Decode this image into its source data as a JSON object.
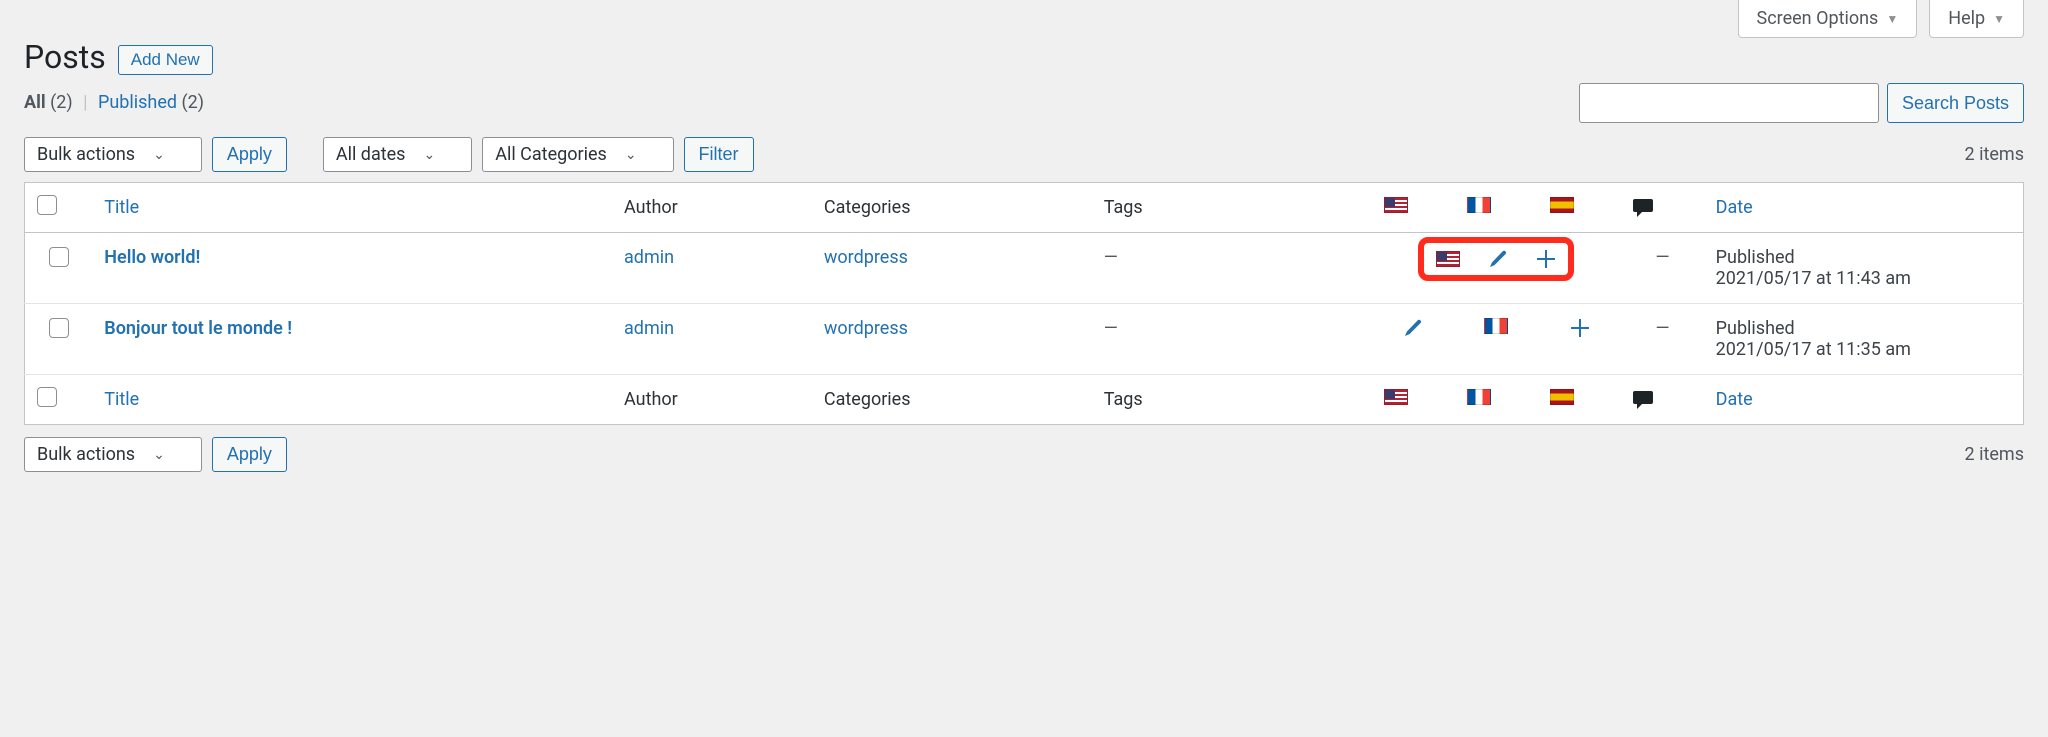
{
  "topTabs": {
    "screenOptions": "Screen Options",
    "help": "Help"
  },
  "heading": "Posts",
  "addNew": "Add New",
  "filters": {
    "allLabel": "All",
    "allCount": "(2)",
    "publishedLabel": "Published",
    "publishedCount": "(2)"
  },
  "search": {
    "button": "Search Posts",
    "placeholder": ""
  },
  "bulk": {
    "label": "Bulk actions",
    "apply": "Apply"
  },
  "dateFilter": "All dates",
  "catFilter": "All Categories",
  "filterBtn": "Filter",
  "itemsCount": "2 items",
  "columns": {
    "title": "Title",
    "author": "Author",
    "categories": "Categories",
    "tags": "Tags",
    "date": "Date"
  },
  "langs": [
    "us",
    "fr",
    "es"
  ],
  "rows": [
    {
      "title": "Hello world!",
      "author": "admin",
      "categories": "wordpress",
      "tags": "—",
      "comments": "—",
      "dateStatus": "Published",
      "dateValue": "2021/05/17 at 11:43 am",
      "langCells": [
        "flag-us",
        "pencil",
        "plus"
      ],
      "highlightLangs": true
    },
    {
      "title": "Bonjour tout le monde !",
      "author": "admin",
      "categories": "wordpress",
      "tags": "—",
      "comments": "—",
      "dateStatus": "Published",
      "dateValue": "2021/05/17 at 11:35 am",
      "langCells": [
        "pencil",
        "flag-fr",
        "plus"
      ],
      "highlightLangs": false
    }
  ]
}
